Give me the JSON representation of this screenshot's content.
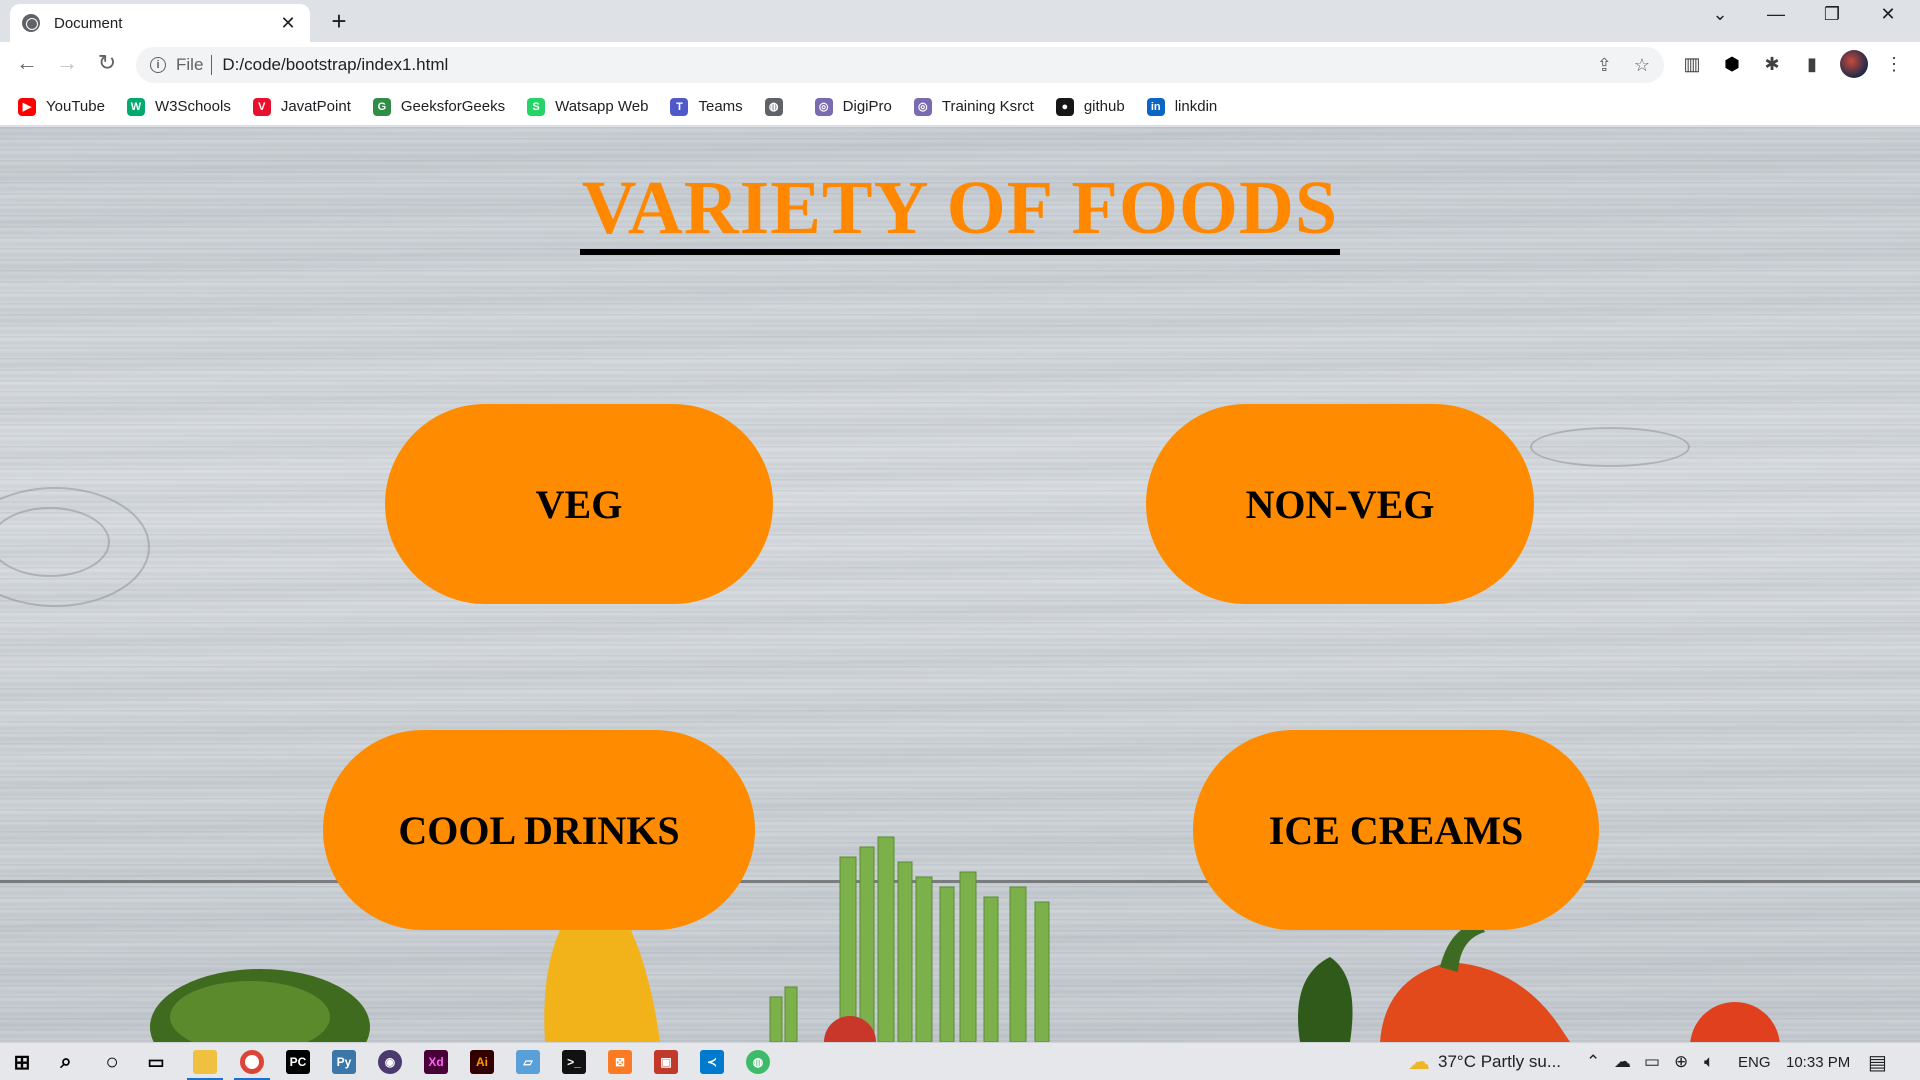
{
  "browser": {
    "tab_title": "Document",
    "tab_close": "✕",
    "new_tab": "+",
    "window_controls": [
      "⌄",
      "—",
      "❐",
      "✕"
    ],
    "scheme": "File",
    "url": "D:/code/bootstrap/index1.html",
    "info_glyph": "i"
  },
  "bookmarks": [
    {
      "label": "YouTube",
      "icon": "youtube-icon",
      "color": "#ff0000",
      "glyph": "▶"
    },
    {
      "label": "W3Schools",
      "icon": "w3schools-icon",
      "color": "#04aa6d",
      "glyph": "W"
    },
    {
      "label": "JavatPoint",
      "icon": "javatpoint-icon",
      "color": "#e8112d",
      "glyph": "V"
    },
    {
      "label": "GeeksforGeeks",
      "icon": "geeksforgeeks-icon",
      "color": "#2f8d46",
      "glyph": "G"
    },
    {
      "label": "Watsapp Web",
      "icon": "whatsapp-icon",
      "color": "#25d366",
      "glyph": "S"
    },
    {
      "label": "Teams",
      "icon": "teams-icon",
      "color": "#5059c9",
      "glyph": "T"
    },
    {
      "label": "",
      "icon": "globe-icon",
      "color": "#5f6368",
      "glyph": "◍"
    },
    {
      "label": "DigiPro",
      "icon": "digipro-icon",
      "color": "#7a6bb0",
      "glyph": "◎"
    },
    {
      "label": "Training Ksrct",
      "icon": "training-icon",
      "color": "#7a6bb0",
      "glyph": "◎"
    },
    {
      "label": "github",
      "icon": "github-icon",
      "color": "#181717",
      "glyph": "●"
    },
    {
      "label": "linkdin",
      "icon": "linkedin-icon",
      "color": "#0a66c2",
      "glyph": "in"
    }
  ],
  "page": {
    "heading": "VARIETY OF FOODS",
    "heading_color": "#ff8800",
    "button_color": "#ff8c00",
    "buttons": {
      "veg": "VEG",
      "nonveg": "NON-VEG",
      "drinks": "COOL DRINKS",
      "icecreams": "ICE CREAMS"
    }
  },
  "taskbar": {
    "weather": "37°C  Partly su...",
    "language": "ENG",
    "time": "10:33 PM"
  }
}
